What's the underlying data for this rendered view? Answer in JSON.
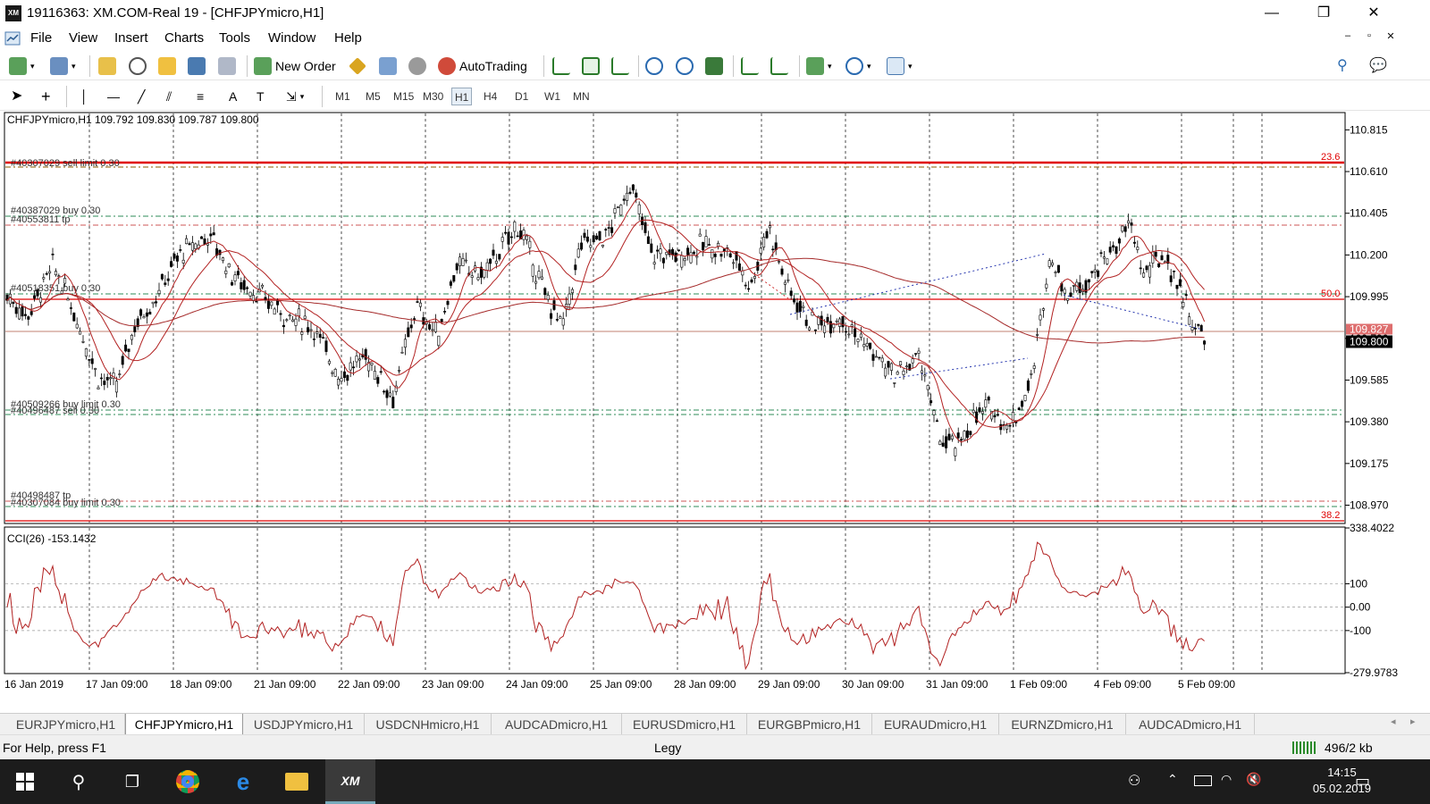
{
  "window": {
    "title": "19116363: XM.COM-Real 19 - [CHFJPYmicro,H1]",
    "app_icon": "XM",
    "minimize": "—",
    "restore": "❐",
    "close": "✕"
  },
  "menu": {
    "items": [
      "File",
      "View",
      "Insert",
      "Charts",
      "Tools",
      "Window",
      "Help"
    ],
    "mdi_controls": [
      "–",
      "▫",
      "✕"
    ]
  },
  "toolbar": {
    "new_order": "New Order",
    "autotrading": "AutoTrading"
  },
  "timeframes": [
    "M1",
    "M5",
    "M15",
    "M30",
    "H1",
    "H4",
    "D1",
    "W1",
    "MN"
  ],
  "active_timeframe": "H1",
  "chart": {
    "header": "CHFJPYmicro,H1  109.792 109.830 109.787 109.800",
    "current_price": "109.800",
    "current_price_faded": "109.827",
    "price_axis": [
      "110.815",
      "110.610",
      "110.405",
      "110.200",
      "109.995",
      "109.790",
      "109.585",
      "109.380",
      "109.175",
      "108.970"
    ],
    "fib_labels": {
      "top": "23.6",
      "mid": "50.0",
      "bottom": "38.2"
    },
    "order_labels": [
      "#40307029 sell limit 0.30",
      "#40387029 buy 0.30",
      "#40553811 tp",
      "#40518351 buy 0.30",
      "#40509266 buy limit 0.30",
      "#40496487 sell 0.30",
      "#40498487 tp",
      "#40307084 buy limit 0.30"
    ],
    "cci_label": "CCI(26) -153.1432",
    "cci_axis": [
      "338.4022",
      "100",
      "0.00",
      "-100",
      "-279.9783"
    ],
    "time_axis": [
      "16 Jan 2019",
      "17 Jan 09:00",
      "18 Jan 09:00",
      "21 Jan 09:00",
      "22 Jan 09:00",
      "23 Jan 09:00",
      "24 Jan 09:00",
      "25 Jan 09:00",
      "28 Jan 09:00",
      "29 Jan 09:00",
      "30 Jan 09:00",
      "31 Jan 09:00",
      "1 Feb 09:00",
      "4 Feb 09:00",
      "5 Feb 09:00"
    ],
    "colors": {
      "candle": "#000000",
      "ma": "#b22222",
      "fib": "#e00000",
      "order_green": "#2e8b57",
      "order_red": "#cc0000",
      "grid": "#000000",
      "price_box": "#000000"
    }
  },
  "tabs": [
    "EURJPYmicro,H1",
    "CHFJPYmicro,H1",
    "USDJPYmicro,H1",
    "USDCNHmicro,H1",
    "AUDCADmicro,H1",
    "EURUSDmicro,H1",
    "EURGBPmicro,H1",
    "EURAUDmicro,H1",
    "EURNZDmicro,H1",
    "AUDCADmicro,H1"
  ],
  "active_tab": 1,
  "status": {
    "help": "For Help, press F1",
    "profile": "Legy",
    "traffic": "496/2 kb"
  },
  "taskbar": {
    "time": "14:15",
    "date": "05.02.2019"
  }
}
